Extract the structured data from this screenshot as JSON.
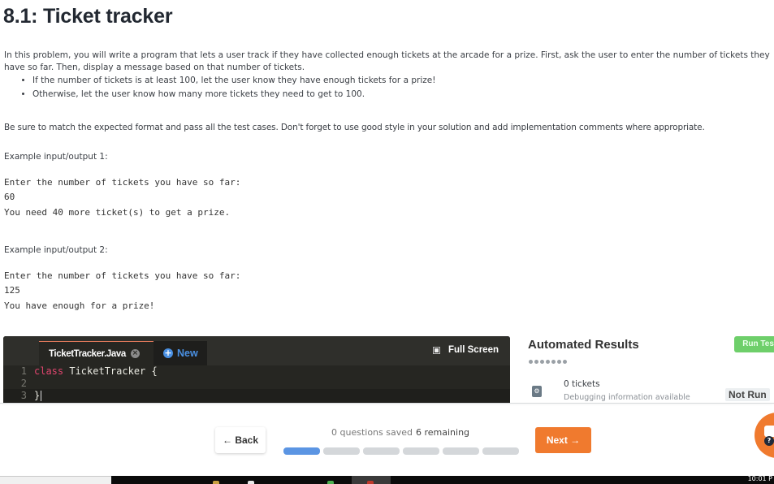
{
  "page": {
    "title": "8.1: Ticket tracker",
    "intro": "In this problem, you will write a program that lets a user track if they have collected enough tickets at the arcade for a prize. First, ask the user to enter the number of tickets they have so far. Then, display a message based on that number of tickets.",
    "bullets": [
      "If the number of tickets is at least 100, let the user know they have enough tickets for a prize!",
      "Otherwise, let the user know how many more tickets they need to get to 100."
    ],
    "note": "Be sure to match the expected format and pass all the test cases. Don't forget to use good style in your solution and add implementation comments where appropriate.",
    "examples": [
      {
        "label": "Example input/output 1:",
        "lines": [
          "Enter the number of tickets you have so far:",
          "60",
          "You need 40 more ticket(s) to get a prize."
        ]
      },
      {
        "label": "Example input/output 2:",
        "lines": [
          "Enter the number of tickets you have so far:",
          "125",
          "You have enough for a prize!"
        ]
      }
    ]
  },
  "editor": {
    "file_tab": "TicketTracker.Java",
    "close_glyph": "×",
    "new_glyph": "+",
    "new_label": "New",
    "fullscreen_label": "Full Screen",
    "code": [
      {
        "num": "1",
        "keyword": "class",
        "rest": " TicketTracker {"
      },
      {
        "num": "2",
        "keyword": "",
        "rest": ""
      },
      {
        "num": "3",
        "keyword": "",
        "rest": "}"
      }
    ]
  },
  "results": {
    "title": "Automated Results",
    "run_label": "Run Tests",
    "dot_count": 7,
    "tests": [
      {
        "name": "0 tickets",
        "debug": "Debugging information available",
        "status": "Not Run",
        "icon": "gears-icon",
        "icon_glyph": "⚙"
      }
    ]
  },
  "footer": {
    "back_label": "← Back",
    "saved_text": "0 questions saved",
    "remaining_text": "6 remaining",
    "progress": {
      "completed": 1,
      "total": 6
    },
    "next_label": "Next →",
    "help_glyph": "?"
  },
  "colors": {
    "accent_orange": "#f07a2e",
    "progress_blue": "#5b95e3",
    "run_green": "#6ecf6a",
    "keyword_pink": "#e0456e",
    "new_blue": "#4a90e2"
  },
  "taskbar": {
    "clock": "10:01 P"
  }
}
